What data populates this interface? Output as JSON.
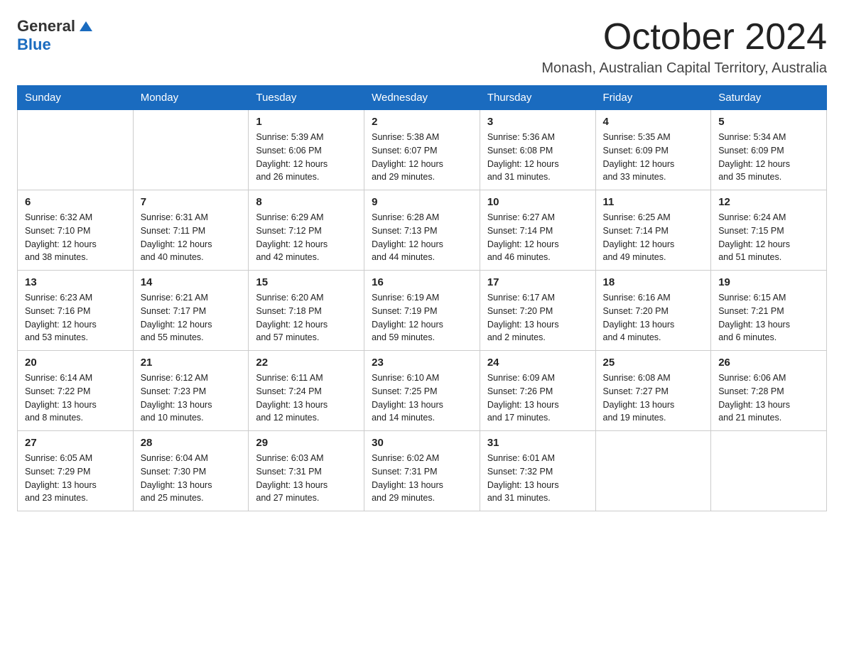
{
  "header": {
    "logo_general": "General",
    "logo_blue": "Blue",
    "month": "October 2024",
    "location": "Monash, Australian Capital Territory, Australia"
  },
  "weekdays": [
    "Sunday",
    "Monday",
    "Tuesday",
    "Wednesday",
    "Thursday",
    "Friday",
    "Saturday"
  ],
  "weeks": [
    [
      {
        "day": "",
        "info": ""
      },
      {
        "day": "",
        "info": ""
      },
      {
        "day": "1",
        "info": "Sunrise: 5:39 AM\nSunset: 6:06 PM\nDaylight: 12 hours\nand 26 minutes."
      },
      {
        "day": "2",
        "info": "Sunrise: 5:38 AM\nSunset: 6:07 PM\nDaylight: 12 hours\nand 29 minutes."
      },
      {
        "day": "3",
        "info": "Sunrise: 5:36 AM\nSunset: 6:08 PM\nDaylight: 12 hours\nand 31 minutes."
      },
      {
        "day": "4",
        "info": "Sunrise: 5:35 AM\nSunset: 6:09 PM\nDaylight: 12 hours\nand 33 minutes."
      },
      {
        "day": "5",
        "info": "Sunrise: 5:34 AM\nSunset: 6:09 PM\nDaylight: 12 hours\nand 35 minutes."
      }
    ],
    [
      {
        "day": "6",
        "info": "Sunrise: 6:32 AM\nSunset: 7:10 PM\nDaylight: 12 hours\nand 38 minutes."
      },
      {
        "day": "7",
        "info": "Sunrise: 6:31 AM\nSunset: 7:11 PM\nDaylight: 12 hours\nand 40 minutes."
      },
      {
        "day": "8",
        "info": "Sunrise: 6:29 AM\nSunset: 7:12 PM\nDaylight: 12 hours\nand 42 minutes."
      },
      {
        "day": "9",
        "info": "Sunrise: 6:28 AM\nSunset: 7:13 PM\nDaylight: 12 hours\nand 44 minutes."
      },
      {
        "day": "10",
        "info": "Sunrise: 6:27 AM\nSunset: 7:14 PM\nDaylight: 12 hours\nand 46 minutes."
      },
      {
        "day": "11",
        "info": "Sunrise: 6:25 AM\nSunset: 7:14 PM\nDaylight: 12 hours\nand 49 minutes."
      },
      {
        "day": "12",
        "info": "Sunrise: 6:24 AM\nSunset: 7:15 PM\nDaylight: 12 hours\nand 51 minutes."
      }
    ],
    [
      {
        "day": "13",
        "info": "Sunrise: 6:23 AM\nSunset: 7:16 PM\nDaylight: 12 hours\nand 53 minutes."
      },
      {
        "day": "14",
        "info": "Sunrise: 6:21 AM\nSunset: 7:17 PM\nDaylight: 12 hours\nand 55 minutes."
      },
      {
        "day": "15",
        "info": "Sunrise: 6:20 AM\nSunset: 7:18 PM\nDaylight: 12 hours\nand 57 minutes."
      },
      {
        "day": "16",
        "info": "Sunrise: 6:19 AM\nSunset: 7:19 PM\nDaylight: 12 hours\nand 59 minutes."
      },
      {
        "day": "17",
        "info": "Sunrise: 6:17 AM\nSunset: 7:20 PM\nDaylight: 13 hours\nand 2 minutes."
      },
      {
        "day": "18",
        "info": "Sunrise: 6:16 AM\nSunset: 7:20 PM\nDaylight: 13 hours\nand 4 minutes."
      },
      {
        "day": "19",
        "info": "Sunrise: 6:15 AM\nSunset: 7:21 PM\nDaylight: 13 hours\nand 6 minutes."
      }
    ],
    [
      {
        "day": "20",
        "info": "Sunrise: 6:14 AM\nSunset: 7:22 PM\nDaylight: 13 hours\nand 8 minutes."
      },
      {
        "day": "21",
        "info": "Sunrise: 6:12 AM\nSunset: 7:23 PM\nDaylight: 13 hours\nand 10 minutes."
      },
      {
        "day": "22",
        "info": "Sunrise: 6:11 AM\nSunset: 7:24 PM\nDaylight: 13 hours\nand 12 minutes."
      },
      {
        "day": "23",
        "info": "Sunrise: 6:10 AM\nSunset: 7:25 PM\nDaylight: 13 hours\nand 14 minutes."
      },
      {
        "day": "24",
        "info": "Sunrise: 6:09 AM\nSunset: 7:26 PM\nDaylight: 13 hours\nand 17 minutes."
      },
      {
        "day": "25",
        "info": "Sunrise: 6:08 AM\nSunset: 7:27 PM\nDaylight: 13 hours\nand 19 minutes."
      },
      {
        "day": "26",
        "info": "Sunrise: 6:06 AM\nSunset: 7:28 PM\nDaylight: 13 hours\nand 21 minutes."
      }
    ],
    [
      {
        "day": "27",
        "info": "Sunrise: 6:05 AM\nSunset: 7:29 PM\nDaylight: 13 hours\nand 23 minutes."
      },
      {
        "day": "28",
        "info": "Sunrise: 6:04 AM\nSunset: 7:30 PM\nDaylight: 13 hours\nand 25 minutes."
      },
      {
        "day": "29",
        "info": "Sunrise: 6:03 AM\nSunset: 7:31 PM\nDaylight: 13 hours\nand 27 minutes."
      },
      {
        "day": "30",
        "info": "Sunrise: 6:02 AM\nSunset: 7:31 PM\nDaylight: 13 hours\nand 29 minutes."
      },
      {
        "day": "31",
        "info": "Sunrise: 6:01 AM\nSunset: 7:32 PM\nDaylight: 13 hours\nand 31 minutes."
      },
      {
        "day": "",
        "info": ""
      },
      {
        "day": "",
        "info": ""
      }
    ]
  ]
}
